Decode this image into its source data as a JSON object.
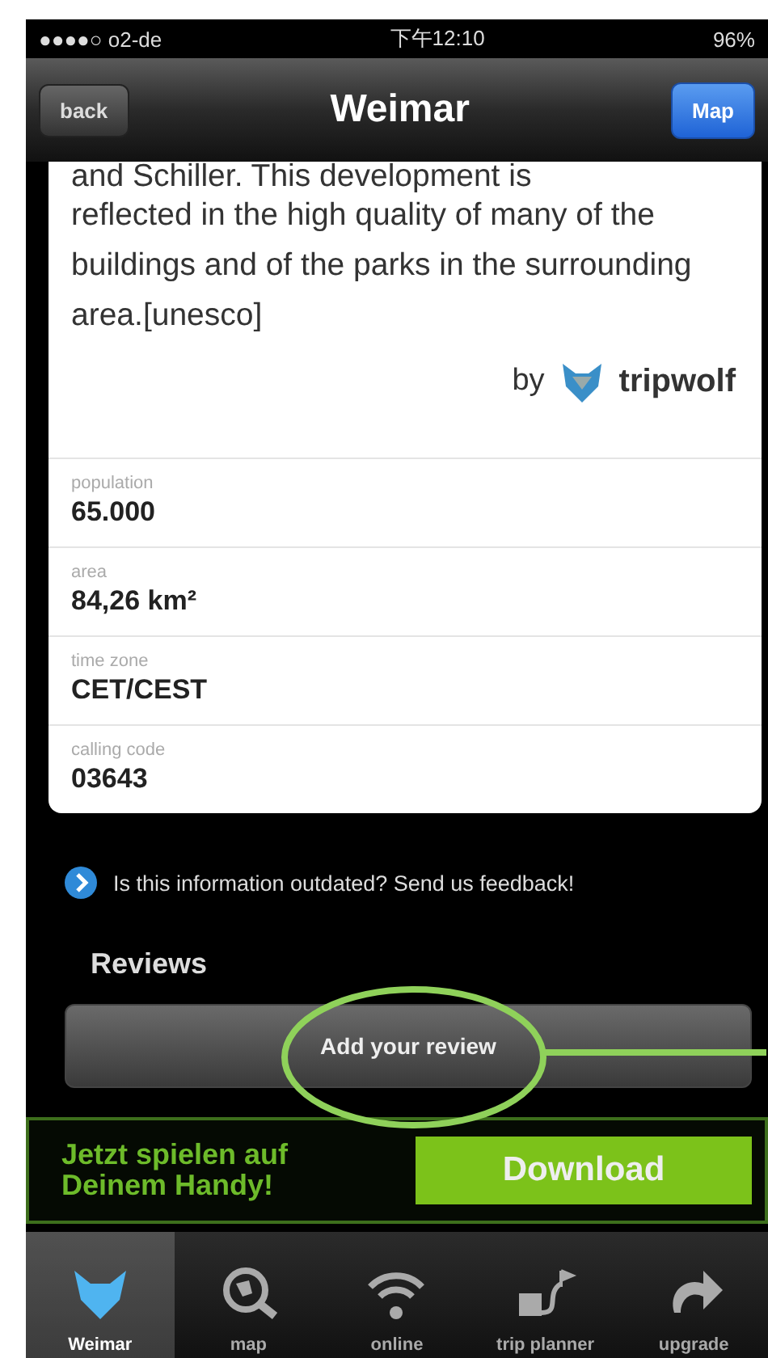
{
  "status_bar": {
    "carrier": "●●●●○ o2-de",
    "time": "下午12:10",
    "battery": "96%"
  },
  "nav": {
    "back": "back",
    "title": "Weimar",
    "action": "Map"
  },
  "description": {
    "lines": [
      "and Schiller. This development is",
      "reflected in the high quality of many of the buildings and of the parks in the surrounding area.[unesco]"
    ],
    "credit_prefix": "by",
    "credit_brand": "tripwolf"
  },
  "facts": [
    {
      "label": "population",
      "value": "65.000"
    },
    {
      "label": "area",
      "value": "84,26 km²"
    },
    {
      "label": "time zone",
      "value": "CET/CEST"
    },
    {
      "label": "calling code",
      "value": "03643"
    }
  ],
  "feedback": "Is this information outdated? Send us feedback!",
  "reviews": {
    "heading": "Reviews",
    "button": "Add your review"
  },
  "ad": {
    "text": "Jetzt spielen auf Deinem Handy!",
    "button": "Download"
  },
  "tabs": [
    {
      "label": "Weimar",
      "selected": true
    },
    {
      "label": "map",
      "selected": false
    },
    {
      "label": "online",
      "selected": false
    },
    {
      "label": "trip planner",
      "selected": false
    },
    {
      "label": "upgrade",
      "selected": false
    }
  ]
}
